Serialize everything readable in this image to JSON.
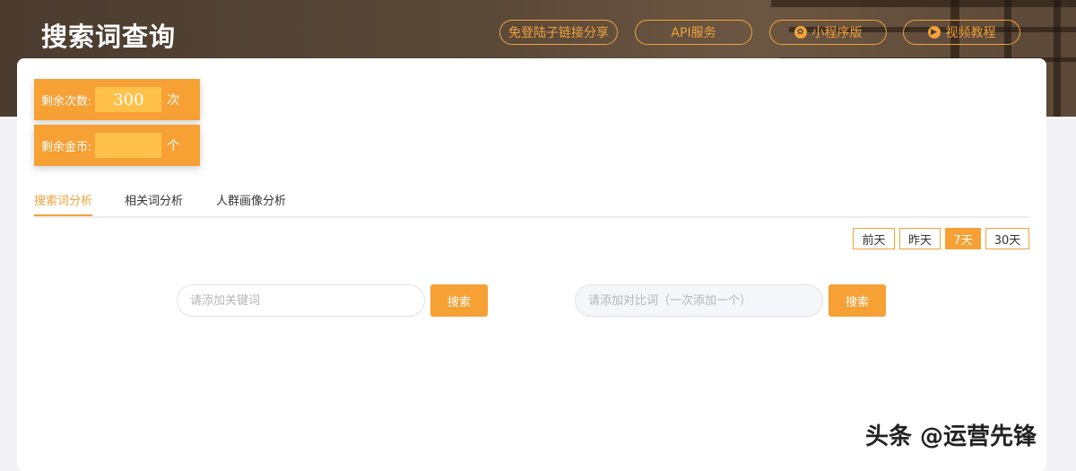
{
  "header": {
    "title": "搜索词查询",
    "buttons": [
      {
        "label": "免登陆子链接分享",
        "icon": ""
      },
      {
        "label": "API服务",
        "icon": ""
      },
      {
        "label": "小程序版",
        "icon": "miniprogram-icon"
      },
      {
        "label": "视频教程",
        "icon": "video-icon"
      }
    ]
  },
  "stats": {
    "remaining_count": {
      "label": "剩余次数:",
      "value": "300",
      "unit": "次"
    },
    "remaining_coins": {
      "label": "剩余金币:",
      "value": "",
      "unit": "个"
    }
  },
  "tabs": [
    {
      "label": "搜索词分析",
      "active": true
    },
    {
      "label": "相关词分析",
      "active": false
    },
    {
      "label": "人群画像分析",
      "active": false
    }
  ],
  "date_range": [
    {
      "label": "前天",
      "active": false
    },
    {
      "label": "昨天",
      "active": false
    },
    {
      "label": "7天",
      "active": true
    },
    {
      "label": "30天",
      "active": false
    }
  ],
  "search": {
    "keyword_placeholder": "请添加关键词",
    "compare_placeholder": "请添加对比词（一次添加一个）",
    "button_label": "搜索"
  },
  "watermark": "头条 @运营先锋",
  "colors": {
    "accent": "#f7a034",
    "header_bg": "#4b3c2f"
  }
}
